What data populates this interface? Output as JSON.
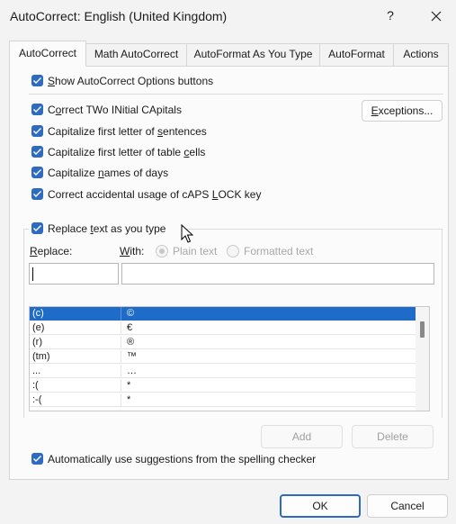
{
  "window": {
    "title": "AutoCorrect: English (United Kingdom)",
    "help_label": "?",
    "close_label": "×"
  },
  "tabs": [
    {
      "label": "AutoCorrect",
      "active": true
    },
    {
      "label": "Math AutoCorrect",
      "active": false
    },
    {
      "label": "AutoFormat As You Type",
      "active": false
    },
    {
      "label": "AutoFormat",
      "active": false
    },
    {
      "label": "Actions",
      "active": false
    }
  ],
  "options": {
    "show_buttons": {
      "pre": "",
      "ul": "S",
      "post": "how AutoCorrect Options buttons",
      "checked": true
    },
    "correct_two_initial": {
      "pre": "C",
      "ul": "o",
      "post": "rrect TWo INitial CApitals",
      "checked": true
    },
    "capitalize_sentences": {
      "pre": "Capitalize first letter of ",
      "ul": "s",
      "post": "entences",
      "checked": true
    },
    "capitalize_table_cells": {
      "pre": "Capitalize first letter of table ",
      "ul": "c",
      "post": "ells",
      "checked": true
    },
    "capitalize_days": {
      "pre": "Capitalize ",
      "ul": "n",
      "post": "ames of days",
      "checked": true
    },
    "caps_lock": {
      "pre": "Correct accidental usage of cAPS ",
      "ul": "L",
      "post": "OCK key",
      "checked": true
    },
    "replace_as_you_type": {
      "pre": "Replace ",
      "ul": "t",
      "post": "ext as you type",
      "checked": true
    },
    "spelling_suggestions": {
      "pre": "Automatically use su",
      "ul": "g",
      "post": "gestions from the spelling checker",
      "checked": true
    }
  },
  "exceptions_button": {
    "ul": "E",
    "post": "xceptions..."
  },
  "replace_section": {
    "replace_label_ul": "R",
    "replace_label_post": "eplace:",
    "with_label_ul": "W",
    "with_label_post": "ith:",
    "plain_text_label": "Plain text",
    "formatted_text_label": "Formatted text",
    "replace_value": "",
    "with_value": ""
  },
  "entries": [
    {
      "replace": "(c)",
      "with": "©",
      "selected": true
    },
    {
      "replace": "(e)",
      "with": "€",
      "selected": false
    },
    {
      "replace": "(r)",
      "with": "®",
      "selected": false
    },
    {
      "replace": "(tm)",
      "with": "™",
      "selected": false
    },
    {
      "replace": "...",
      "with": "…",
      "selected": false
    },
    {
      "replace": ":(",
      "with": "*",
      "selected": false
    },
    {
      "replace": ":-(",
      "with": "*",
      "selected": false
    }
  ],
  "buttons": {
    "add": "Add",
    "delete": "Delete",
    "ok": "OK",
    "cancel": "Cancel"
  },
  "colors": {
    "accent": "#2e6bbf",
    "selection": "#1f6cc8"
  }
}
